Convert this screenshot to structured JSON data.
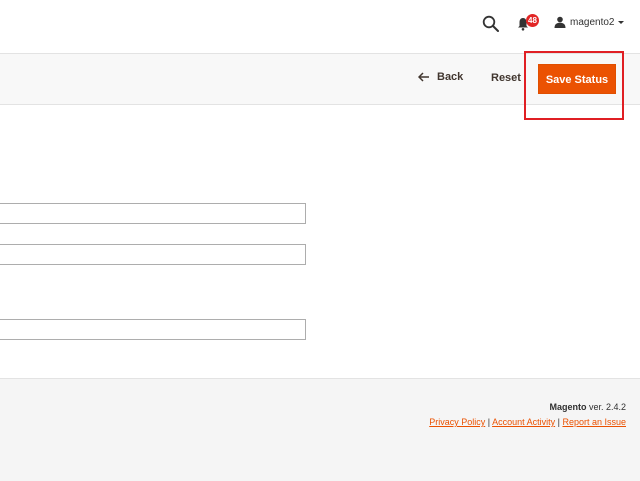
{
  "header": {
    "notifications_count": "48",
    "user_name": "magento2"
  },
  "action_bar": {
    "back_label": "Back",
    "reset_label": "Reset",
    "save_label": "Save Status",
    "accent_color": "#eb5202",
    "highlight_color": "#e01f24"
  },
  "form": {
    "fields": [
      {
        "value": ""
      },
      {
        "value": ""
      },
      {
        "value": ""
      }
    ]
  },
  "footer": {
    "brand": "Magento",
    "version_text": " ver. 2.4.2",
    "links": {
      "privacy": "Privacy Policy",
      "sep1": " | ",
      "account": "Account Activity",
      "sep2": " | ",
      "report": "Report an Issue"
    }
  }
}
